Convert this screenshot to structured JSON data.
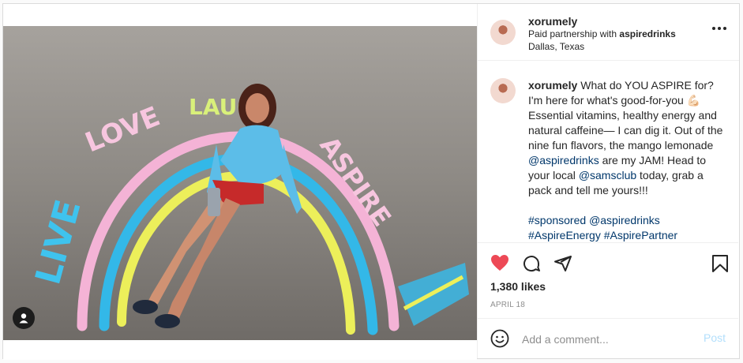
{
  "post": {
    "username": "xorumely",
    "partnership_prefix": "Paid partnership with ",
    "partner": "aspiredrinks",
    "location": "Dallas, Texas",
    "caption": {
      "text1": "What do YOU ASPIRE for? I'm here for what's good-for-you 💪🏻 Essential vitamins, healthy energy and natural caffeine— I can dig it. Out of the nine fun flavors, the mango lemonade ",
      "mention1": "@aspiredrinks",
      "text2": " are my JAM! Head to your local ",
      "mention2": "@samsclub",
      "text3": " today, grab a pack and tell me yours!!!",
      "tag1": "#sponsored",
      "tag2": "@aspiredrinks",
      "tag3": "#AspireEnergy",
      "tag4": "#AspirePartner"
    },
    "likes": "1,380 likes",
    "date": "APRIL 18"
  },
  "photo": {
    "chalk_words": [
      "LIVE",
      "LOVE",
      "LAUGH",
      "ASPIRE"
    ]
  },
  "comment": {
    "placeholder": "Add a comment...",
    "post_label": "Post"
  },
  "icons": {
    "like": "heart-icon",
    "comment": "comment-icon",
    "share": "share-icon",
    "save": "bookmark-icon",
    "emoji": "emoji-icon",
    "more": "more-icon",
    "tagged": "user-tag-icon"
  },
  "colors": {
    "heart": "#ed4956",
    "link": "#00376b",
    "post_button_disabled": "#b2dffc"
  }
}
